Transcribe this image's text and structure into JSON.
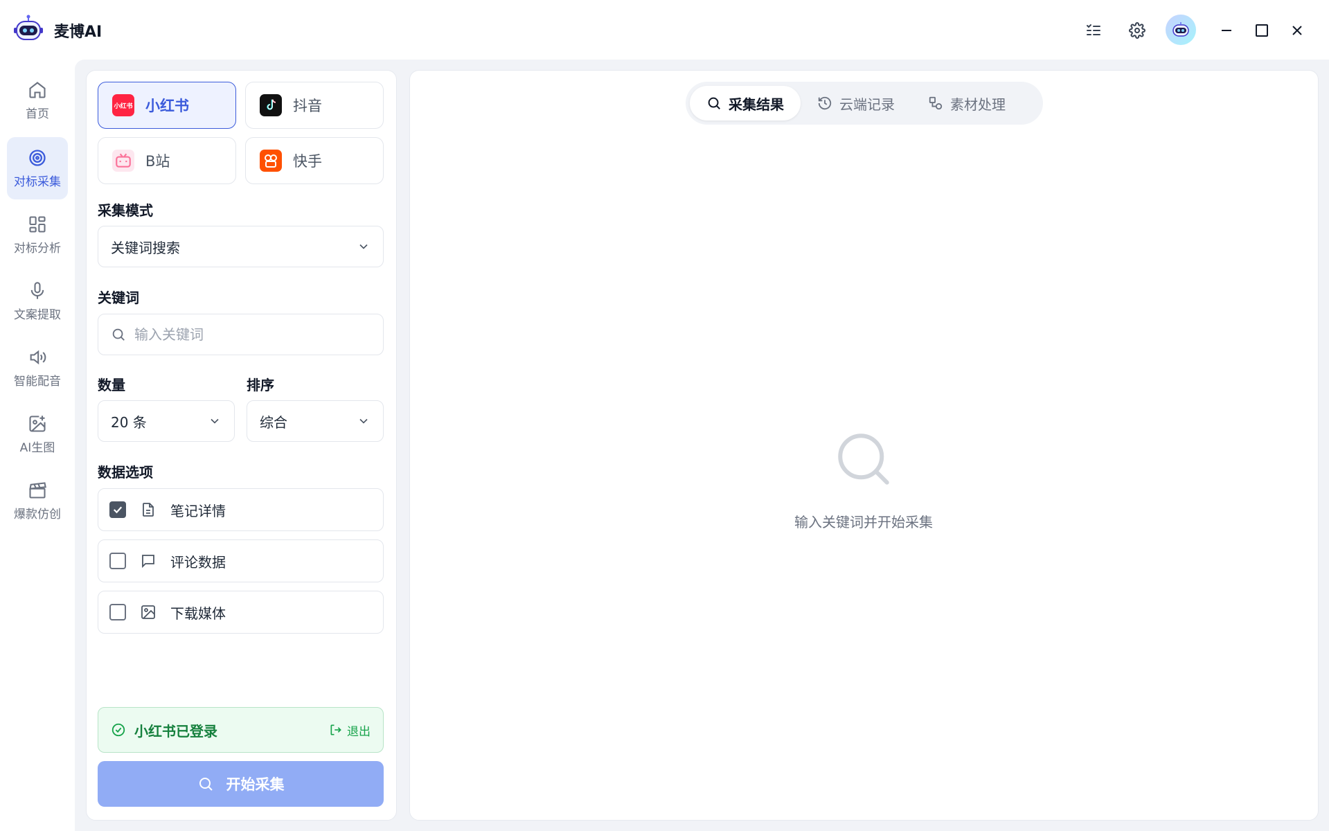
{
  "app": {
    "title": "麦博AI"
  },
  "nav": [
    {
      "label": "首页",
      "icon": "home-icon"
    },
    {
      "label": "对标采集",
      "icon": "target-icon"
    },
    {
      "label": "对标分析",
      "icon": "grid-icon"
    },
    {
      "label": "文案提取",
      "icon": "microphone-icon"
    },
    {
      "label": "智能配音",
      "icon": "speaker-icon"
    },
    {
      "label": "AI生图",
      "icon": "image-plus-icon"
    },
    {
      "label": "爆款仿创",
      "icon": "clapperboard-icon"
    }
  ],
  "platforms": [
    {
      "label": "小红书",
      "badge": "小红书",
      "color": "#ff2442"
    },
    {
      "label": "抖音",
      "color": "#111111"
    },
    {
      "label": "B站",
      "color": "#fb7299"
    },
    {
      "label": "快手",
      "color": "#ff5000"
    }
  ],
  "form": {
    "mode_label": "采集模式",
    "mode_value": "关键词搜索",
    "keyword_label": "关键词",
    "keyword_placeholder": "输入关键词",
    "count_label": "数量",
    "count_value": "20 条",
    "sort_label": "排序",
    "sort_value": "综合",
    "options_label": "数据选项",
    "options": [
      {
        "label": "笔记详情",
        "checked": true,
        "icon": "document-icon"
      },
      {
        "label": "评论数据",
        "checked": false,
        "icon": "comment-icon"
      },
      {
        "label": "下载媒体",
        "checked": false,
        "icon": "image-icon"
      }
    ]
  },
  "login": {
    "status": "小红书已登录",
    "logout": "退出"
  },
  "start_button": "开始采集",
  "tabs": [
    {
      "label": "采集结果",
      "icon": "search-icon"
    },
    {
      "label": "云端记录",
      "icon": "history-icon"
    },
    {
      "label": "素材处理",
      "icon": "shapes-icon"
    }
  ],
  "empty_state": {
    "text": "输入关键词并开始采集"
  },
  "colors": {
    "accent": "#3b5bdb",
    "success": "#15803d",
    "button": "#91acf5"
  }
}
